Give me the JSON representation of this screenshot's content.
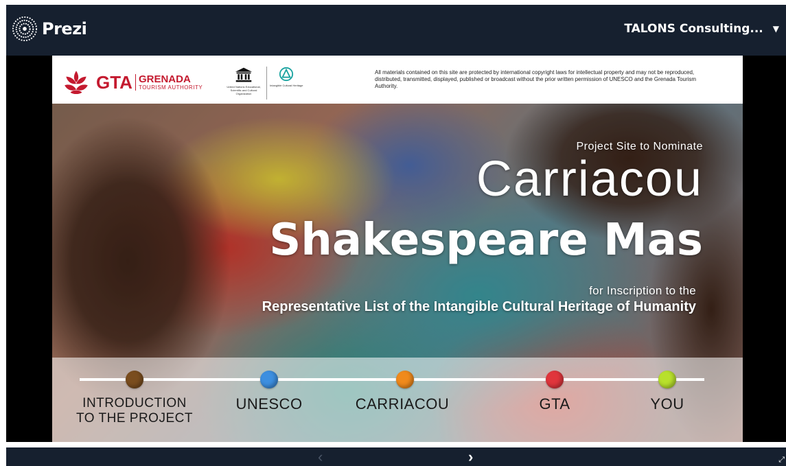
{
  "app": {
    "name": "Prezi",
    "account": "TALONS Consulting..."
  },
  "slide": {
    "header": {
      "gta": {
        "main": "GTA",
        "sub1": "GRENADA",
        "sub2": "TOURISM AUTHORITY"
      },
      "unesco": {
        "caption": "United Nations Educational, Scientific and Cultural Organization",
        "ich_caption": "Intangible Cultural Heritage"
      },
      "copyright": "All materials contained on this site are protected by international copyright laws for intellectual property and may not be reproduced, distributed, transmitted, displayed, published or broadcast without the prior written permission of UNESCO and the Grenada Tourism Authority."
    },
    "title": {
      "nominate": "Project Site to Nominate",
      "main": "Carriacou",
      "bold": "Shakespeare Mas",
      "inscription": "for Inscription to the",
      "representative": "Representative List of the Intangible Cultural Heritage of Humanity"
    },
    "timeline": [
      {
        "label_line1": "INTRODUCTION",
        "label_line2": "TO THE PROJECT",
        "color": "#7a4d1e"
      },
      {
        "label_line1": "UNESCO",
        "label_line2": "",
        "color": "#3d8fe0"
      },
      {
        "label_line1": "CARRIACOU",
        "label_line2": "",
        "color": "#f08a1c"
      },
      {
        "label_line1": "GTA",
        "label_line2": "",
        "color": "#e0353c"
      },
      {
        "label_line1": "YOU",
        "label_line2": "",
        "color": "#b8e02c"
      }
    ]
  },
  "nav": {
    "prev": "‹",
    "next": "›",
    "fullscreen": "⤢"
  },
  "icons": [
    "prezi-logo-icon",
    "gta-logo-icon",
    "unesco-temple-icon",
    "ich-icon",
    "caret-down-icon",
    "chevron-left-icon",
    "chevron-right-icon",
    "fullscreen-icon"
  ],
  "colors": {
    "topbar": "#16202f",
    "gta_red": "#c41a2f",
    "background": "#000000"
  }
}
